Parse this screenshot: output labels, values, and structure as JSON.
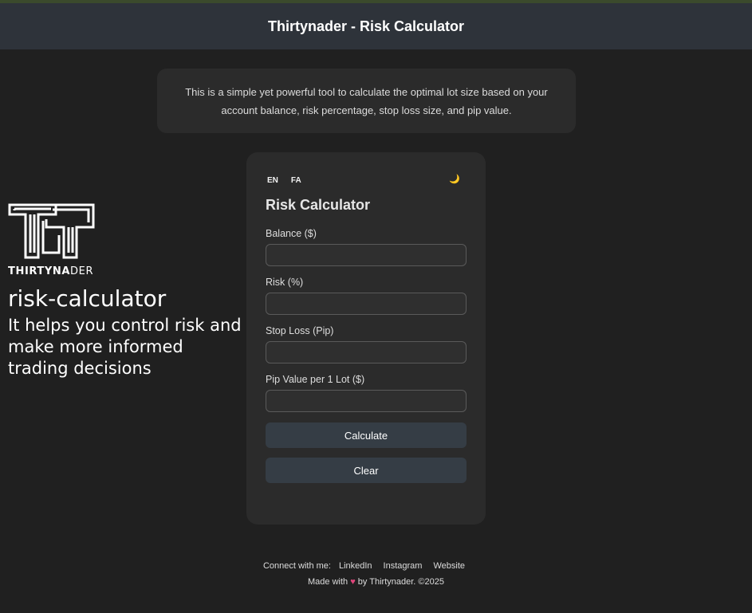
{
  "header": {
    "title": "Thirtynader - Risk Calculator"
  },
  "intro": {
    "text": "This is a simple yet powerful tool to calculate the optimal lot size based on your account balance, risk percentage, stop loss size, and pip value."
  },
  "brand": {
    "logo_word_bold": "THIRTYNA",
    "logo_word_light": "DER",
    "name": "risk-calculator",
    "tagline": "It helps you control risk and make more informed trading decisions"
  },
  "calculator": {
    "lang_en": "EN",
    "lang_fa": "FA",
    "theme_icon": "moon-icon",
    "theme_glyph": "🌙",
    "title": "Risk Calculator",
    "fields": [
      {
        "label": "Balance ($)",
        "value": "",
        "placeholder": ""
      },
      {
        "label": "Risk (%)",
        "value": "",
        "placeholder": ""
      },
      {
        "label": "Stop Loss (Pip)",
        "value": "",
        "placeholder": ""
      },
      {
        "label": "Pip Value per 1 Lot ($)",
        "value": "",
        "placeholder": ""
      }
    ],
    "calculate_label": "Calculate",
    "clear_label": "Clear"
  },
  "footer": {
    "connect_label": "Connect with me:",
    "links": [
      "LinkedIn",
      "Instagram",
      "Website"
    ],
    "made_with": "Made with",
    "heart": "♥",
    "credit": "by Thirtynader. ©2025"
  },
  "colors": {
    "background": "#202020",
    "header": "#2e333a",
    "card": "#2b2b2b",
    "button": "#353d45",
    "heart": "#e0457b"
  }
}
